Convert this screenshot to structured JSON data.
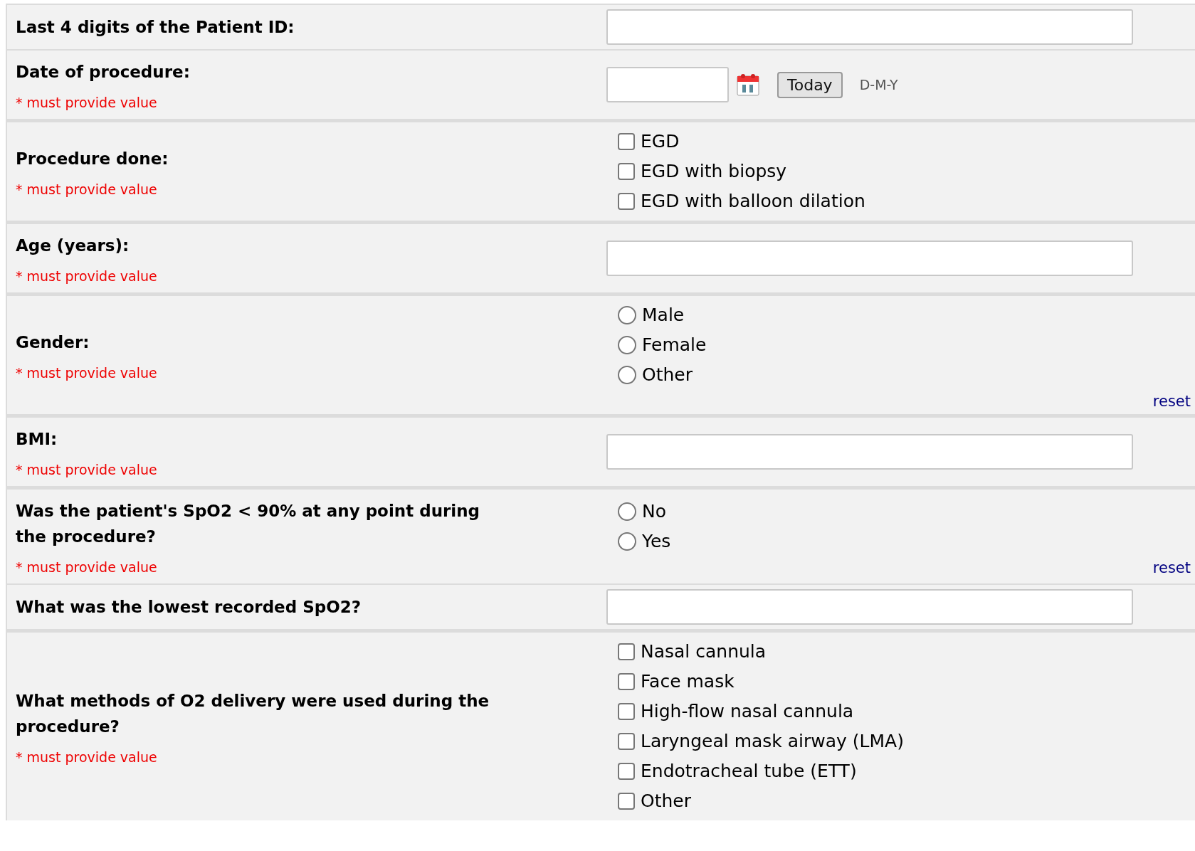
{
  "fields": [
    {
      "kind": "text",
      "label": "Last 4 digits of the Patient ID:"
    },
    {
      "kind": "date",
      "label": "Date of procedure:",
      "note": "* must provide value",
      "button": "Today",
      "format": "D-M-Y"
    },
    {
      "kind": "checkbox",
      "label": "Procedure done:",
      "note": "* must provide value",
      "options": [
        {
          "label": "EGD",
          "checked": false
        },
        {
          "label": "EGD with biopsy",
          "checked": false
        },
        {
          "label": "EGD with balloon dilation",
          "checked": false
        }
      ]
    },
    {
      "kind": "text",
      "label": "Age (years):",
      "note": "* must provide value"
    },
    {
      "kind": "radio",
      "label": "Gender:",
      "note": "* must provide value",
      "options": [
        {
          "label": "Male",
          "selected": false
        },
        {
          "label": "Female",
          "selected": false
        },
        {
          "label": "Other",
          "selected": false
        }
      ],
      "reset": "reset"
    },
    {
      "kind": "text",
      "label": "BMI:",
      "note": "* must provide value"
    },
    {
      "kind": "radio",
      "label": "Was the patient's SpO2 < 90% at any point during the procedure?",
      "note": "* must provide value",
      "options": [
        {
          "label": "No",
          "selected": false
        },
        {
          "label": "Yes",
          "selected": false
        }
      ],
      "reset": "reset"
    },
    {
      "kind": "text",
      "label": "What was the lowest recorded SpO2?"
    },
    {
      "kind": "checkbox",
      "label": "What methods of O2 delivery were used during the procedure?",
      "note": "* must provide value",
      "options": [
        {
          "label": "Nasal cannula",
          "checked": false
        },
        {
          "label": "Face mask",
          "checked": false
        },
        {
          "label": "High-flow nasal cannula",
          "checked": false
        },
        {
          "label": "Laryngeal mask airway (LMA)",
          "checked": false
        },
        {
          "label": "Endotracheal tube (ETT)",
          "checked": false
        },
        {
          "label": "Other",
          "checked": false
        }
      ]
    }
  ]
}
